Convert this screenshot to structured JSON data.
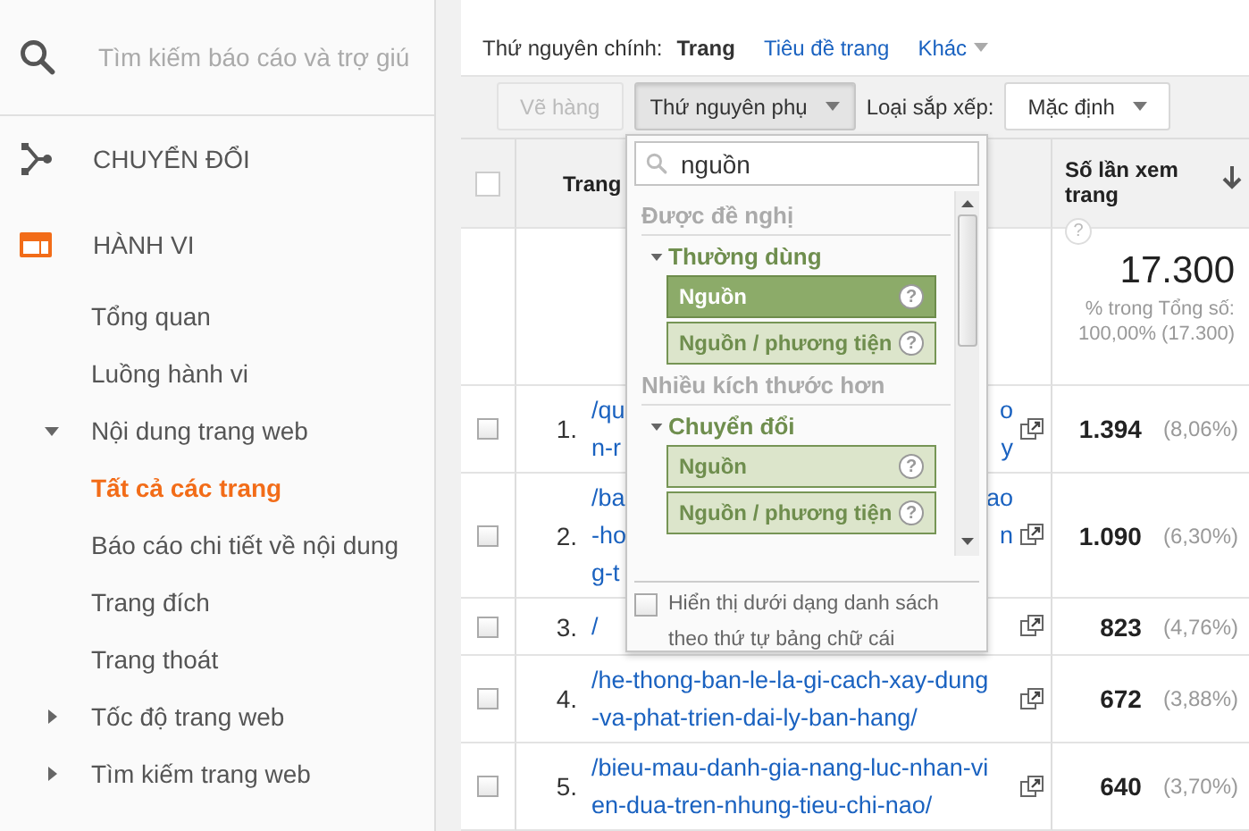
{
  "sidebar": {
    "search": {
      "placeholder": "Tìm kiếm báo cáo và trợ giú"
    },
    "sections": [
      {
        "label": "CHUYỂN ĐỔI",
        "kind": "conversions"
      },
      {
        "label": "HÀNH VI",
        "kind": "behavior"
      }
    ],
    "items": [
      {
        "label": "Tổng quan",
        "kind": "leaf",
        "selected": false
      },
      {
        "label": "Luồng hành vi",
        "kind": "leaf",
        "selected": false
      },
      {
        "label": "Nội dung trang web",
        "kind": "group",
        "expanded": true,
        "selected": false
      },
      {
        "label": "Tất cả các trang",
        "kind": "leaf",
        "selected": true
      },
      {
        "label": "Báo cáo chi tiết về nội dung",
        "kind": "leaf",
        "selected": false
      },
      {
        "label": "Trang đích",
        "kind": "leaf",
        "selected": false
      },
      {
        "label": "Trang thoát",
        "kind": "leaf",
        "selected": false
      },
      {
        "label": "Tốc độ trang web",
        "kind": "group",
        "expanded": false,
        "selected": false
      },
      {
        "label": "Tìm kiếm trang web",
        "kind": "group",
        "expanded": false,
        "selected": false
      }
    ]
  },
  "primary_dimension": {
    "label": "Thứ nguyên chính:",
    "options": [
      {
        "label": "Trang",
        "kind": "link",
        "selected": true
      },
      {
        "label": "Tiêu đề trang",
        "kind": "link",
        "selected": false
      },
      {
        "label": "Khác",
        "kind": "menu",
        "selected": false
      }
    ]
  },
  "toolbar": {
    "plot_button": {
      "label": "Vẽ hàng",
      "disabled": true
    },
    "secondary_dimension": {
      "label": "Thứ nguyên phụ",
      "expanded": true
    },
    "sort_label": "Loại sắp xếp:",
    "sort_select": {
      "value": "Mặc định"
    }
  },
  "table": {
    "select_all": {
      "checked": false
    },
    "columns": [
      {
        "label": "Trang"
      },
      {
        "label": "Số lần xem trang",
        "help": "?",
        "sorted": true
      }
    ],
    "summary": {
      "value": "17.300",
      "note": "% trong Tổng số: 100,00% (17.300)"
    },
    "rows": [
      {
        "checked": false,
        "index": "1.",
        "path_lines": [
          [
            "/qu",
            "o"
          ],
          [
            "n-r",
            "y"
          ]
        ],
        "views": "1.394",
        "share": "(8,06%)"
      },
      {
        "checked": false,
        "index": "2.",
        "path_lines": [
          [
            "/ba",
            "ao"
          ],
          [
            "-ho",
            "n"
          ],
          [
            "g-t"
          ]
        ],
        "views": "1.090",
        "share": "(6,30%)"
      },
      {
        "checked": false,
        "index": "3.",
        "path_lines": [
          [
            "/"
          ]
        ],
        "views": "823",
        "share": "(4,76%)"
      },
      {
        "checked": false,
        "index": "4.",
        "path_lines": [
          [
            "/he-thong-ban-le-la-gi-cach-xay-dung"
          ],
          [
            "-va-phat-trien-dai-ly-ban-hang/"
          ]
        ],
        "views": "672",
        "share": "(3,88%)"
      },
      {
        "checked": false,
        "index": "5.",
        "path_lines": [
          [
            "/bieu-mau-danh-gia-nang-luc-nhan-vi"
          ],
          [
            "en-dua-tren-nhung-tieu-chi-nao/"
          ]
        ],
        "views": "640",
        "share": "(3,70%)"
      }
    ]
  },
  "dimension_menu": {
    "search": {
      "value": "nguồn"
    },
    "groups": [
      {
        "heading": "Được đề nghị",
        "categories": [
          {
            "label": "Thường dùng",
            "expanded": true,
            "items": [
              {
                "label": "Nguồn",
                "help": "?",
                "selected": true
              },
              {
                "label": "Nguồn / phương tiện",
                "help": "?",
                "selected": false
              }
            ]
          }
        ]
      },
      {
        "heading": "Nhiều kích thước hơn",
        "categories": [
          {
            "label": "Chuyển đổi",
            "expanded": true,
            "items": [
              {
                "label": "Nguồn",
                "help": "?",
                "selected": false
              },
              {
                "label": "Nguồn / phương tiện",
                "help": "?",
                "selected": false
              }
            ]
          }
        ]
      }
    ],
    "alphabetical": {
      "label": "Hiển thị dưới dạng danh sách theo thứ tự bảng chữ cái",
      "checked": false
    }
  }
}
